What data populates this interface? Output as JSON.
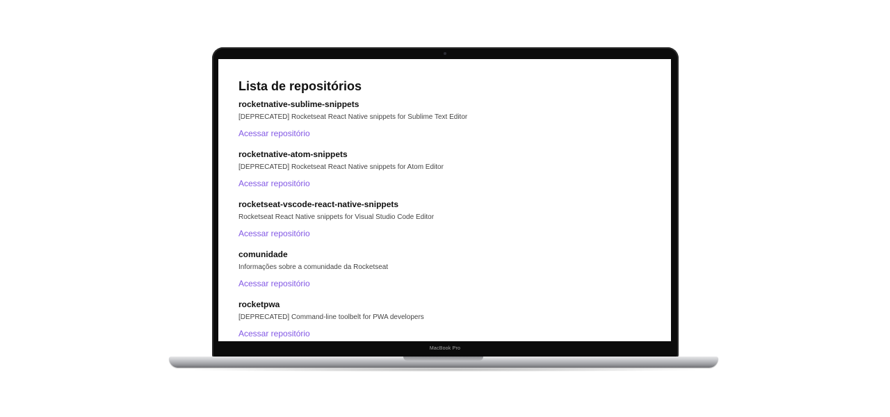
{
  "device": {
    "brand_label": "MacBook Pro"
  },
  "page": {
    "title": "Lista de repositórios",
    "link_color": "#8257e5"
  },
  "repositories": [
    {
      "name": "rocketnative-sublime-snippets",
      "description": "[DEPRECATED] Rocketseat React Native snippets for Sublime Text Editor",
      "link_label": "Acessar repositório"
    },
    {
      "name": "rocketnative-atom-snippets",
      "description": "[DEPRECATED] Rocketseat React Native snippets for Atom Editor",
      "link_label": "Acessar repositório"
    },
    {
      "name": "rocketseat-vscode-react-native-snippets",
      "description": "Rocketseat React Native snippets for Visual Studio Code Editor",
      "link_label": "Acessar repositório"
    },
    {
      "name": "comunidade",
      "description": "Informações sobre a comunidade da Rocketseat",
      "link_label": "Acessar repositório"
    },
    {
      "name": "rocketpwa",
      "description": "[DEPRECATED] Command-line toolbelt for PWA developers",
      "link_label": "Acessar repositório"
    }
  ]
}
